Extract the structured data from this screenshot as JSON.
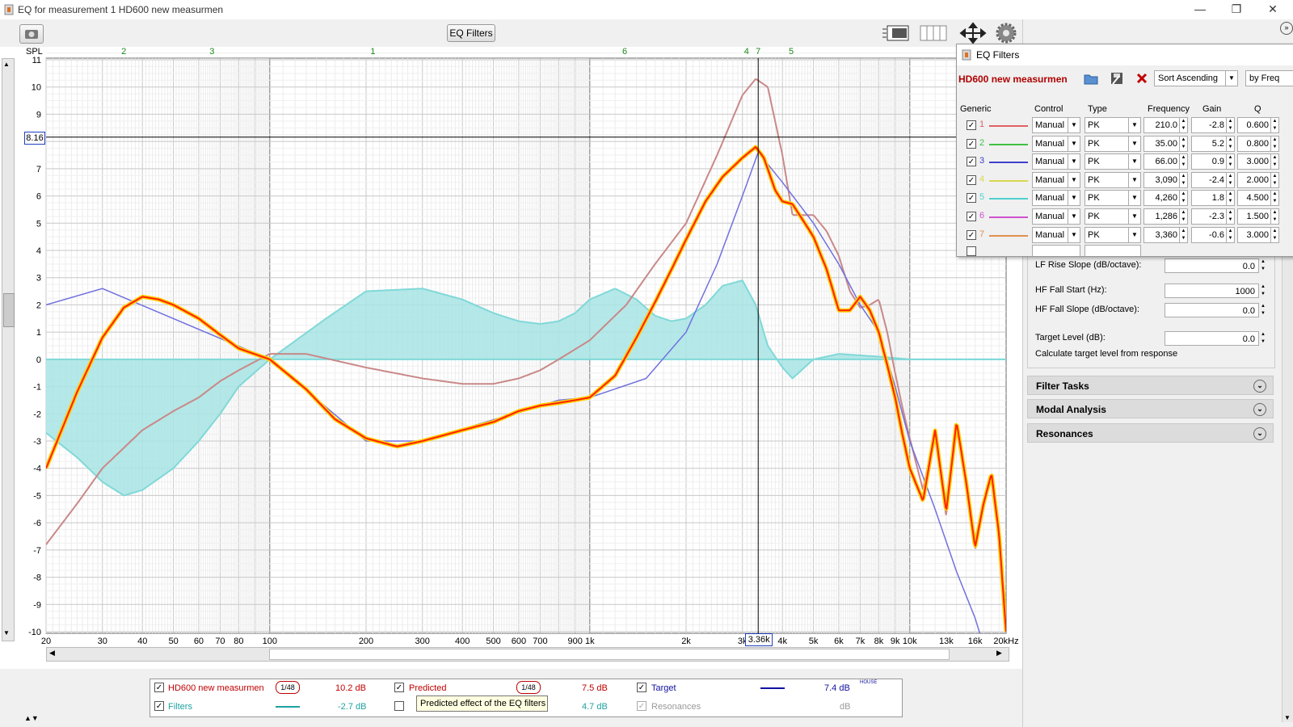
{
  "window": {
    "title": "EQ for measurement 1 HD600 new measurmen",
    "minimize": "—",
    "restore": "❐",
    "close": "✕"
  },
  "toolbar": {
    "eq_filters_button": "EQ Filters"
  },
  "chart_data": {
    "type": "line",
    "y_axis_label": "SPL",
    "x_scale": "log",
    "xlim": [
      20,
      20000
    ],
    "ylim": [
      -10,
      12
    ],
    "y_ticks": [
      "11",
      "10",
      "9",
      "8",
      "7",
      "6",
      "5",
      "4",
      "3",
      "2",
      "1",
      "0",
      "-1",
      "-2",
      "-3",
      "-4",
      "-5",
      "-6",
      "-7",
      "-8",
      "-9",
      "-10"
    ],
    "x_ticks": [
      "20",
      "30",
      "40",
      "50",
      "60",
      "70",
      "80",
      "100",
      "200",
      "300",
      "400",
      "500",
      "600",
      "700",
      "900",
      "1k",
      "2k",
      "3k",
      "4k",
      "5k",
      "6k",
      "7k",
      "8k",
      "9k",
      "10k",
      "13k",
      "16k",
      "20kHz"
    ],
    "cursor": {
      "y": "8.16",
      "x": "3.36k"
    },
    "filter_markers": [
      "2",
      "3",
      "1",
      "6",
      "4",
      "7",
      "5"
    ],
    "series": [
      {
        "name": "HD600 new measurmen",
        "color": "#c98888",
        "x": [
          20,
          25,
          30,
          40,
          50,
          60,
          70,
          80,
          100,
          130,
          200,
          300,
          400,
          500,
          600,
          700,
          800,
          1000,
          1300,
          1600,
          2000,
          2500,
          3000,
          3300,
          3600,
          4000,
          4300,
          5000,
          5500,
          6000,
          6500,
          7000,
          7500,
          8000,
          8500,
          9000,
          9500,
          10000,
          11000,
          12000,
          13000,
          14000,
          15000,
          16000,
          17000,
          18000,
          19000,
          20000
        ],
        "y": [
          -6.8,
          -5.3,
          -4,
          -2.6,
          -1.9,
          -1.4,
          -0.8,
          -0.4,
          0.2,
          0.2,
          -0.3,
          -0.7,
          -0.9,
          -0.9,
          -0.7,
          -0.4,
          0,
          0.7,
          2,
          3.5,
          5,
          7.5,
          9.7,
          10.3,
          10,
          7.5,
          5.3,
          5.3,
          4.7,
          3.8,
          2.5,
          1.9,
          2,
          2.2,
          1,
          -0.5,
          -1.8,
          -2.9,
          -4.8,
          -2.6,
          -5.8,
          -2.3,
          -4.8,
          -7,
          -5.5,
          -4.2,
          -6.5,
          -10
        ]
      },
      {
        "name": "Target",
        "color": "#7070e0",
        "x": [
          20,
          30,
          100,
          200,
          300,
          800,
          1000,
          1500,
          2000,
          2500,
          3000,
          3360,
          4000,
          5000,
          6000,
          7000,
          8000,
          9000,
          10000,
          12000,
          14000,
          16000,
          17000
        ],
        "y": [
          2,
          2.6,
          0,
          -3,
          -3,
          -1.5,
          -1.4,
          -0.7,
          1,
          3.5,
          6,
          7.6,
          6.5,
          5,
          3.5,
          2,
          1,
          -1,
          -3,
          -5.5,
          -7.8,
          -9.5,
          -10.5
        ]
      },
      {
        "name": "Filters",
        "color": "#80d8d8",
        "x": [
          20,
          25,
          30,
          35,
          40,
          50,
          60,
          70,
          80,
          100,
          150,
          200,
          300,
          400,
          500,
          600,
          700,
          800,
          900,
          1000,
          1200,
          1400,
          1600,
          1800,
          2000,
          2300,
          2600,
          3000,
          3300,
          3600,
          4000,
          4300,
          5000,
          6000,
          8000,
          10000,
          20000
        ],
        "y": [
          -2.7,
          -3.6,
          -4.5,
          -5,
          -4.8,
          -4,
          -3,
          -2,
          -1,
          0,
          1.5,
          2.5,
          2.6,
          2.2,
          1.7,
          1.4,
          1.3,
          1.4,
          1.7,
          2.2,
          2.6,
          2.2,
          1.6,
          1.4,
          1.5,
          2,
          2.7,
          2.9,
          2,
          0.5,
          -0.3,
          -0.7,
          0,
          0.2,
          0.1,
          0,
          0
        ]
      },
      {
        "name": "Predicted",
        "color": "#ff2000",
        "x": [
          20,
          25,
          30,
          35,
          40,
          45,
          50,
          60,
          70,
          80,
          100,
          130,
          160,
          200,
          250,
          300,
          400,
          500,
          600,
          700,
          800,
          900,
          1000,
          1200,
          1400,
          1600,
          1800,
          2000,
          2300,
          2600,
          3000,
          3300,
          3500,
          3800,
          4000,
          4300,
          4700,
          5000,
          5500,
          6000,
          6500,
          7000,
          7500,
          8000,
          8500,
          9000,
          9500,
          10000,
          11000,
          12000,
          13000,
          14000,
          15000,
          16000,
          17000,
          18000,
          19000,
          20000
        ],
        "y": [
          -4,
          -1.2,
          0.8,
          1.9,
          2.3,
          2.2,
          2,
          1.5,
          0.9,
          0.4,
          0,
          -1.1,
          -2.2,
          -2.9,
          -3.2,
          -3,
          -2.6,
          -2.3,
          -1.9,
          -1.7,
          -1.6,
          -1.5,
          -1.4,
          -0.6,
          0.8,
          2.1,
          3.3,
          4.4,
          5.8,
          6.7,
          7.4,
          7.8,
          7.4,
          6.2,
          5.8,
          5.7,
          5,
          4.5,
          3.3,
          1.8,
          1.8,
          2.3,
          1.8,
          1,
          -0.2,
          -1.4,
          -2.8,
          -4,
          -5.2,
          -2.6,
          -5.6,
          -2.3,
          -4.5,
          -6.9,
          -5.3,
          -4.2,
          -6.4,
          -10
        ]
      }
    ]
  },
  "right_panel": {
    "lf_rise_slope_label": "LF Rise Slope (dB/octave):",
    "lf_rise_slope_value": "0.0",
    "hf_fall_start_label": "HF Fall Start (Hz):",
    "hf_fall_start_value": "1000",
    "hf_fall_slope_label": "HF Fall Slope (dB/octave):",
    "hf_fall_slope_value": "0.0",
    "target_level_label": "Target Level (dB):",
    "target_level_value": "0.0",
    "calc_target_link": "Calculate target level from response",
    "sections": [
      "Filter Tasks",
      "Modal Analysis",
      "Resonances"
    ]
  },
  "eq_window": {
    "title": "EQ Filters",
    "measurement_name": "HD600 new measurmen",
    "sort_select": "Sort Ascending",
    "sort_by_select": "by Freq",
    "headers": {
      "generic": "Generic",
      "control": "Control",
      "type": "Type",
      "frequency": "Frequency",
      "gain": "Gain",
      "q": "Q"
    },
    "filters": [
      {
        "num": "1",
        "color": "#e06060",
        "control": "Manual",
        "type": "PK",
        "freq": "210.0",
        "gain": "-2.8",
        "q": "0.600"
      },
      {
        "num": "2",
        "color": "#40c040",
        "control": "Manual",
        "type": "PK",
        "freq": "35.00",
        "gain": "5.2",
        "q": "0.800"
      },
      {
        "num": "3",
        "color": "#4040d0",
        "control": "Manual",
        "type": "PK",
        "freq": "66.00",
        "gain": "0.9",
        "q": "3.000"
      },
      {
        "num": "4",
        "color": "#d8d850",
        "control": "Manual",
        "type": "PK",
        "freq": "3,090",
        "gain": "-2.4",
        "q": "2.000"
      },
      {
        "num": "5",
        "color": "#50d0d0",
        "control": "Manual",
        "type": "PK",
        "freq": "4,260",
        "gain": "1.8",
        "q": "4.500"
      },
      {
        "num": "6",
        "color": "#d050d0",
        "control": "Manual",
        "type": "PK",
        "freq": "1,286",
        "gain": "-2.3",
        "q": "1.500"
      },
      {
        "num": "7",
        "color": "#e09050",
        "control": "Manual",
        "type": "PK",
        "freq": "3,360",
        "gain": "-0.6",
        "q": "3.000"
      }
    ]
  },
  "legend": {
    "items": [
      {
        "name": "HD600 new measurmen",
        "color": "#c00000",
        "smoothing": "1/48",
        "value": "10.2 dB",
        "checked": true
      },
      {
        "name": "Predicted",
        "color": "#c00000",
        "smoothing": "1/48",
        "value": "7.5 dB",
        "checked": true
      },
      {
        "name": "Target",
        "color": "#1010a0",
        "value": "7.4 dB",
        "sup": "HOUSE",
        "checked": true
      },
      {
        "name": "Filters",
        "color": "#20a0a0",
        "value": "-2.7 dB",
        "checked": true
      },
      {
        "name": "",
        "color": "#20a0a0",
        "value": "4.7 dB",
        "checked": false
      },
      {
        "name": "Resonances",
        "color": "#999999",
        "value": "dB",
        "checked": true
      }
    ],
    "tooltip": "Predicted effect of the EQ filters"
  }
}
